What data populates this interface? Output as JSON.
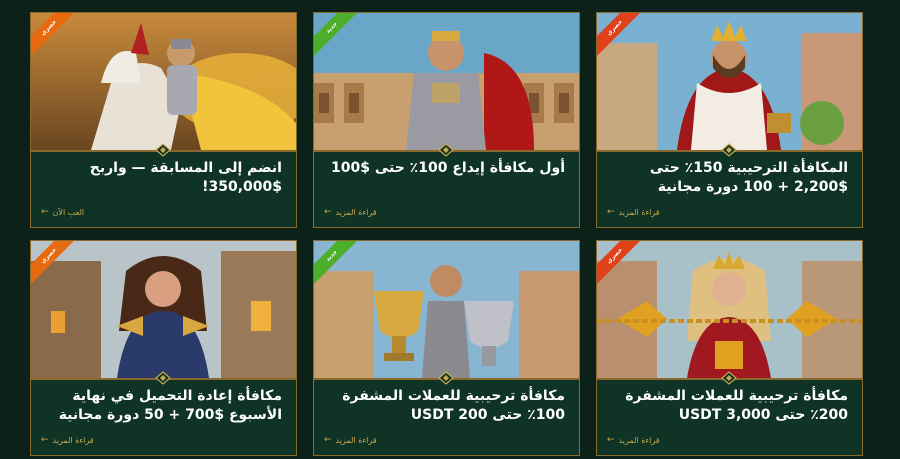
{
  "cards": [
    {
      "ribbon": "حصري",
      "title": "انضم إلى المسابقة — واربح $350,000!",
      "link": "العب الآن",
      "scene": "knight"
    },
    {
      "ribbon": "جديد",
      "title": "أول مكافأة إيداع 100٪ حتى $100",
      "link": "قراءة المزيد",
      "scene": "gladiator"
    },
    {
      "ribbon": "حصري",
      "title": "المكافأة الترحيبية 150٪ حتى $2,200 + 100 دورة مجانية",
      "link": "قراءة المزيد",
      "scene": "king"
    },
    {
      "ribbon": "حصري",
      "title": "مكافأة إعادة التحميل في نهاية الأسبوع $700 + 50 دورة مجانية",
      "link": "قراءة المزيد",
      "scene": "warrior-woman"
    },
    {
      "ribbon": "جديد",
      "title": "مكافأة ترحيبية للعملات المشفرة 100٪ حتى 200 USDT",
      "link": "قراءة المزيد",
      "scene": "trophies"
    },
    {
      "ribbon": "حصري",
      "title": "مكافأة ترحيبية للعملات المشفرة 200٪ حتى 3,000 USDT",
      "link": "قراءة المزيد",
      "scene": "queen-crypto"
    }
  ]
}
